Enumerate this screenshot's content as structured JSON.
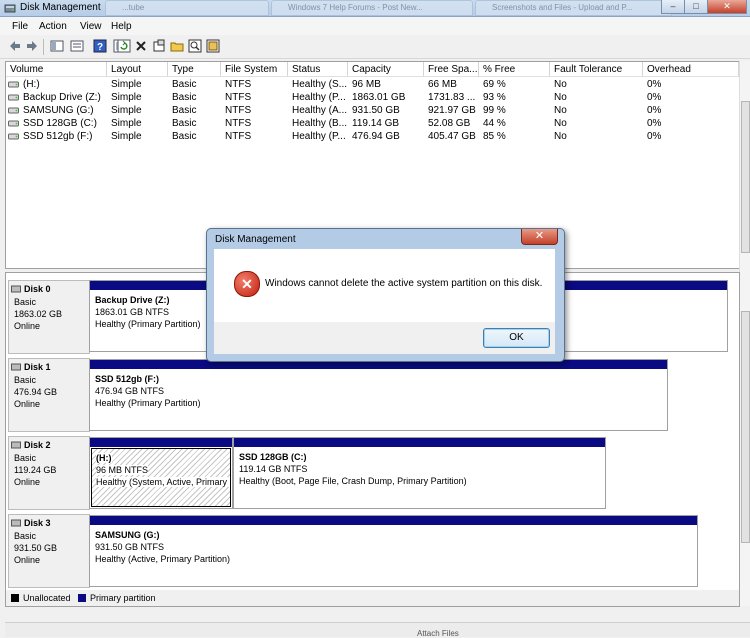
{
  "window": {
    "title": "Disk Management"
  },
  "browser_tabs": [
    {
      "label": "...tube"
    },
    {
      "label": "Windows 7 Help Forums - Post New..."
    },
    {
      "label": "Screenshots and Files - Upload and P..."
    }
  ],
  "menu": [
    "File",
    "Action",
    "View",
    "Help"
  ],
  "toolbar_icons": [
    "back-icon",
    "forward-icon",
    "up-icon",
    "properties-icon",
    "help-icon",
    "refresh-icon",
    "delete-icon",
    "settings-icon",
    "open-icon",
    "search-icon",
    "export-icon"
  ],
  "volume_table": {
    "columns": [
      "Volume",
      "Layout",
      "Type",
      "File System",
      "Status",
      "Capacity",
      "Free Spa...",
      "% Free",
      "Fault Tolerance",
      "Overhead"
    ],
    "rows": [
      [
        "(H:)",
        "Simple",
        "Basic",
        "NTFS",
        "Healthy (S...",
        "96 MB",
        "66 MB",
        "69 %",
        "No",
        "0%"
      ],
      [
        "Backup Drive (Z:)",
        "Simple",
        "Basic",
        "NTFS",
        "Healthy (P...",
        "1863.01 GB",
        "1731.83 ...",
        "93 %",
        "No",
        "0%"
      ],
      [
        "SAMSUNG (G:)",
        "Simple",
        "Basic",
        "NTFS",
        "Healthy (A...",
        "931.50 GB",
        "921.97 GB",
        "99 %",
        "No",
        "0%"
      ],
      [
        "SSD 128GB (C:)",
        "Simple",
        "Basic",
        "NTFS",
        "Healthy (B...",
        "119.14 GB",
        "52.08 GB",
        "44 %",
        "No",
        "0%"
      ],
      [
        "SSD 512gb (F:)",
        "Simple",
        "Basic",
        "NTFS",
        "Healthy (P...",
        "476.94 GB",
        "405.47 GB",
        "85 %",
        "No",
        "0%"
      ]
    ]
  },
  "disks": [
    {
      "name": "Disk 0",
      "type": "Basic",
      "size": "1863.02 GB",
      "state": "Online",
      "partitions": [
        {
          "name": "Backup Drive  (Z:)",
          "size": "1863.01 GB NTFS",
          "status": "Healthy (Primary Partition)"
        }
      ]
    },
    {
      "name": "Disk 1",
      "type": "Basic",
      "size": "476.94 GB",
      "state": "Online",
      "partitions": [
        {
          "name": "SSD 512gb  (F:)",
          "size": "476.94 GB NTFS",
          "status": "Healthy (Primary Partition)"
        }
      ]
    },
    {
      "name": "Disk 2",
      "type": "Basic",
      "size": "119.24 GB",
      "state": "Online",
      "partitions": [
        {
          "name": "(H:)",
          "size": "96 MB NTFS",
          "status": "Healthy (System, Active, Primary"
        },
        {
          "name": "SSD 128GB  (C:)",
          "size": "119.14 GB NTFS",
          "status": "Healthy (Boot, Page File, Crash Dump, Primary Partition)"
        }
      ]
    },
    {
      "name": "Disk 3",
      "type": "Basic",
      "size": "931.50 GB",
      "state": "Online",
      "partitions": [
        {
          "name": "SAMSUNG  (G:)",
          "size": "931.50 GB NTFS",
          "status": "Healthy (Active, Primary Partition)"
        }
      ]
    }
  ],
  "legend": {
    "unallocated": "Unallocated",
    "primary": "Primary partition"
  },
  "dialog": {
    "title": "Disk Management",
    "message": "Windows cannot delete the active system partition on this disk.",
    "close_label": "✕",
    "ok_label": "OK",
    "icon": "error-icon"
  },
  "statusbar_text": "Attach Files",
  "colors": {
    "primary_partition": "#0a0a82",
    "unallocated": "#000000",
    "title_bar": "#c9dbee"
  }
}
